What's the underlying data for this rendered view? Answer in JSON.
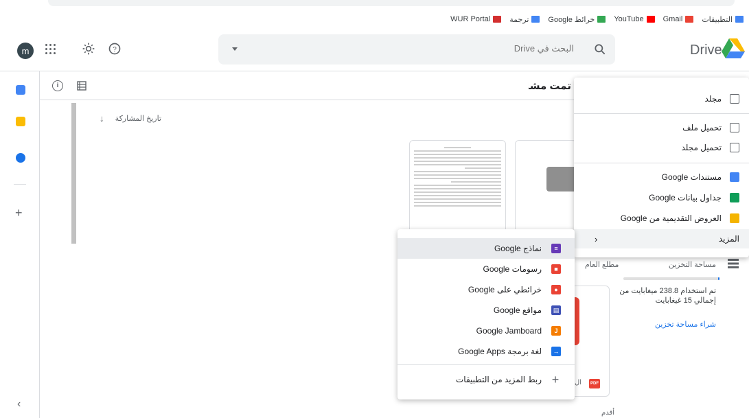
{
  "bookmarks": [
    {
      "label": "التطبيقات",
      "icon": "apps-grid-icon",
      "color": "#4285f4"
    },
    {
      "label": "Gmail",
      "icon": "gmail-icon",
      "color": "#ea4335"
    },
    {
      "label": "YouTube",
      "icon": "youtube-icon",
      "color": "#ff0000"
    },
    {
      "label": "خرائط Google",
      "icon": "maps-icon",
      "color": "#34a853"
    },
    {
      "label": "ترجمة",
      "icon": "translate-icon",
      "color": "#4285f4"
    },
    {
      "label": "WUR Portal",
      "icon": "the-icon",
      "color": "#d32f2f"
    }
  ],
  "header": {
    "avatar_letter": "m",
    "search_placeholder": "البحث في Drive",
    "app_title": "Drive"
  },
  "content": {
    "page_title": "تمت مشاركتها معي",
    "share_date_label": "تاريخ المشاركة",
    "section_label": "مطلع العام",
    "older_label": "أقدم",
    "pdf_name": "ال"
  },
  "storage": {
    "title": "مساحة التخزين",
    "usage_text": "تم استخدام 238.8 ميغابايت من إجمالي 15 غيغابايت",
    "used_fraction": 0.016,
    "buy_label": "شراء مساحة تخزين"
  },
  "new_menu": {
    "items": [
      {
        "label": "مجلد",
        "icon": "new-folder-icon"
      },
      {
        "label": "تحميل ملف",
        "icon": "file-upload-icon"
      },
      {
        "label": "تحميل مجلد",
        "icon": "folder-upload-icon"
      },
      {
        "label": "مستندات Google",
        "icon": "docs-icon",
        "color": "#4285f4"
      },
      {
        "label": "جداول بيانات Google",
        "icon": "sheets-icon",
        "color": "#0f9d58"
      },
      {
        "label": "العروض التقديمية من Google",
        "icon": "slides-icon",
        "color": "#f4b400"
      },
      {
        "label": "المزيد",
        "icon": "chevron-left-icon"
      }
    ]
  },
  "more_menu": {
    "items": [
      {
        "label": "نماذج Google",
        "icon": "forms-icon",
        "color": "#673ab7"
      },
      {
        "label": "رسومات Google",
        "icon": "drawings-icon",
        "color": "#ea4335"
      },
      {
        "label": "خرائطي على Google",
        "icon": "mymaps-icon",
        "color": "#ea4335"
      },
      {
        "label": "مواقع Google",
        "icon": "sites-icon",
        "color": "#3f51b5"
      },
      {
        "label": "Google Jamboard",
        "icon": "jamboard-icon",
        "color": "#f57c00"
      },
      {
        "label": "لغة برمجة Google Apps",
        "icon": "apps-script-icon",
        "color": "#1a73e8"
      },
      {
        "label": "ربط المزيد من التطبيقات",
        "icon": "plus-icon"
      }
    ]
  }
}
